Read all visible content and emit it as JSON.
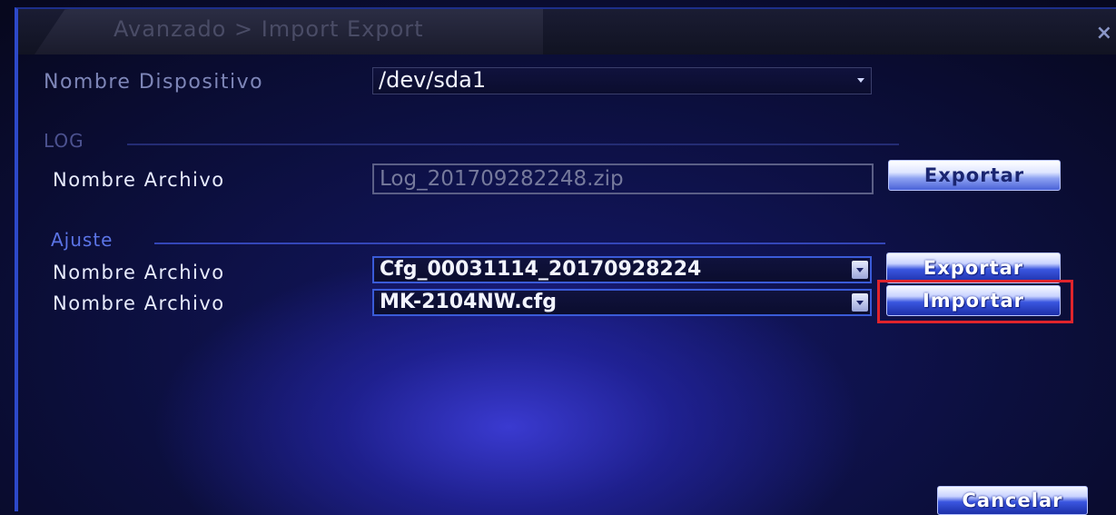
{
  "window": {
    "title": "Avanzado > Import Export",
    "close_glyph": "×"
  },
  "device": {
    "label": "Nombre Dispositivo",
    "value": "/dev/sda1"
  },
  "log_section": {
    "title": "LOG",
    "file_label": "Nombre Archivo",
    "file_value": "Log_201709282248.zip",
    "export_label": "Exportar"
  },
  "ajuste_section": {
    "title": "Ajuste",
    "export_row": {
      "file_label": "Nombre Archivo",
      "file_value": "Cfg_00031114_20170928224",
      "button_label": "Exportar"
    },
    "import_row": {
      "file_label": "Nombre Archivo",
      "file_value": "MK-2104NW.cfg",
      "button_label": "Importar"
    }
  },
  "footer": {
    "cancel_label": "Cancelar"
  },
  "colors": {
    "highlight": "#e0242c",
    "accent": "#3a5bd8"
  }
}
